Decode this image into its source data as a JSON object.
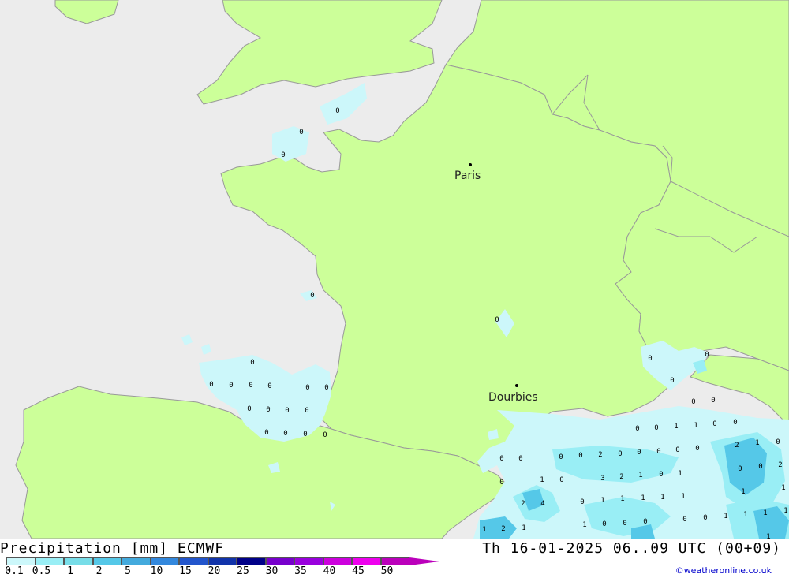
{
  "title": "Precipitation [mm] ECMWF",
  "valid_time": "Th 16-01-2025 06..09 UTC (00+09)",
  "credit": "©weatheronline.co.uk",
  "colors": {
    "sea": "#ececec",
    "land": "#ccff99",
    "border": "#999999",
    "precip_light": "#ccf7fa",
    "precip_mid": "#99eef5",
    "precip_dark": "#55c8e8"
  },
  "cities": [
    {
      "name": "Paris"
    },
    {
      "name": "Dourbies"
    }
  ],
  "scale": {
    "labels": [
      "0.1",
      "0.5",
      "1",
      "2",
      "5",
      "10",
      "15",
      "20",
      "25",
      "30",
      "35",
      "40",
      "45",
      "50"
    ],
    "colors": [
      "#ccf7fa",
      "#99eef5",
      "#77dde8",
      "#55c8e8",
      "#44aadd",
      "#3388dd",
      "#2255cc",
      "#1133aa",
      "#000088",
      "#7700cc",
      "#9900dd",
      "#cc00dd",
      "#ee00ee",
      "#bb00bb"
    ]
  },
  "values": [
    "0",
    "0",
    "0",
    "0",
    "0",
    "0",
    "0",
    "0",
    "0",
    "0",
    "0",
    "0",
    "0",
    "0",
    "0",
    "0",
    "0",
    "0",
    "0",
    "0",
    "0",
    "0",
    "0",
    "0",
    "0",
    "0",
    "0",
    "0",
    "0",
    "1",
    "1",
    "0",
    "0",
    "0",
    "0",
    "0",
    "0",
    "2",
    "0",
    "0",
    "0",
    "0",
    "2",
    "1",
    "0",
    "3",
    "2",
    "1",
    "0",
    "1",
    "0",
    "0",
    "2",
    "1",
    "0",
    "1",
    "2",
    "4",
    "0",
    "1",
    "1",
    "1",
    "1",
    "1",
    "1",
    "1",
    "0",
    "0",
    "0",
    "0",
    "0",
    "1",
    "1",
    "1",
    "1",
    "1",
    "2",
    "1",
    "1",
    "1",
    "1",
    "2"
  ]
}
